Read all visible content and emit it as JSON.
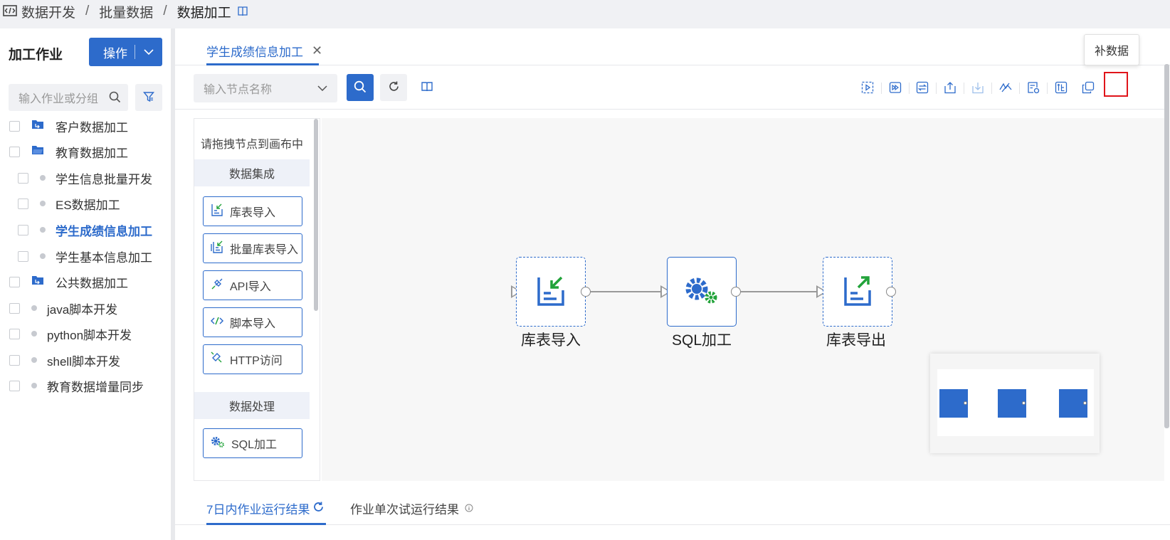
{
  "breadcrumb": {
    "items": [
      "数据开发",
      "批量数据",
      "数据加工"
    ],
    "separator": "/"
  },
  "sidebar": {
    "title": "加工作业",
    "operation_button": "操作",
    "search_placeholder": "输入作业或分组",
    "tree": [
      {
        "label": "客户数据加工",
        "type": "folder",
        "indent": 0
      },
      {
        "label": "教育数据加工",
        "type": "folder-open",
        "indent": 0
      },
      {
        "label": "学生信息批量开发",
        "type": "job",
        "indent": 1
      },
      {
        "label": "ES数据加工",
        "type": "job",
        "indent": 1
      },
      {
        "label": "学生成绩信息加工",
        "type": "job",
        "indent": 1,
        "active": true
      },
      {
        "label": "学生基本信息加工",
        "type": "job",
        "indent": 1
      },
      {
        "label": "公共数据加工",
        "type": "folder",
        "indent": 0
      },
      {
        "label": "java脚本开发",
        "type": "job",
        "indent": 0
      },
      {
        "label": "python脚本开发",
        "type": "job",
        "indent": 0
      },
      {
        "label": "shell脚本开发",
        "type": "job",
        "indent": 0
      },
      {
        "label": "教育数据增量同步",
        "type": "job",
        "indent": 0
      }
    ]
  },
  "editor": {
    "tab_label": "学生成绩信息加工",
    "tooltip": "补数据",
    "node_search_placeholder": "输入节点名称",
    "toolbar_icons": [
      "run-node-icon",
      "run-forward-icon",
      "compare-icon",
      "publish-icon",
      "download-icon",
      "debug-icon",
      "schedule-config-icon",
      "backfill-data-icon",
      "copy-icon"
    ]
  },
  "palette": {
    "hint": "请拖拽节点到画布中",
    "groups": [
      {
        "title": "数据集成",
        "items": [
          "库表导入",
          "批量库表导入",
          "API导入",
          "脚本导入",
          "HTTP访问"
        ]
      },
      {
        "title": "数据处理",
        "items": [
          "SQL加工"
        ]
      }
    ]
  },
  "flow": {
    "nodes": [
      {
        "label": "库表导入",
        "style": "dashed"
      },
      {
        "label": "SQL加工",
        "style": "solid"
      },
      {
        "label": "库表导出",
        "style": "dashed"
      }
    ]
  },
  "results": {
    "tab_active": "7日内作业运行结果",
    "tab_inactive": "作业单次试运行结果"
  },
  "colors": {
    "primary": "#2d6bcb",
    "accent_green": "#22a33a",
    "highlight_red": "#e0141a"
  }
}
